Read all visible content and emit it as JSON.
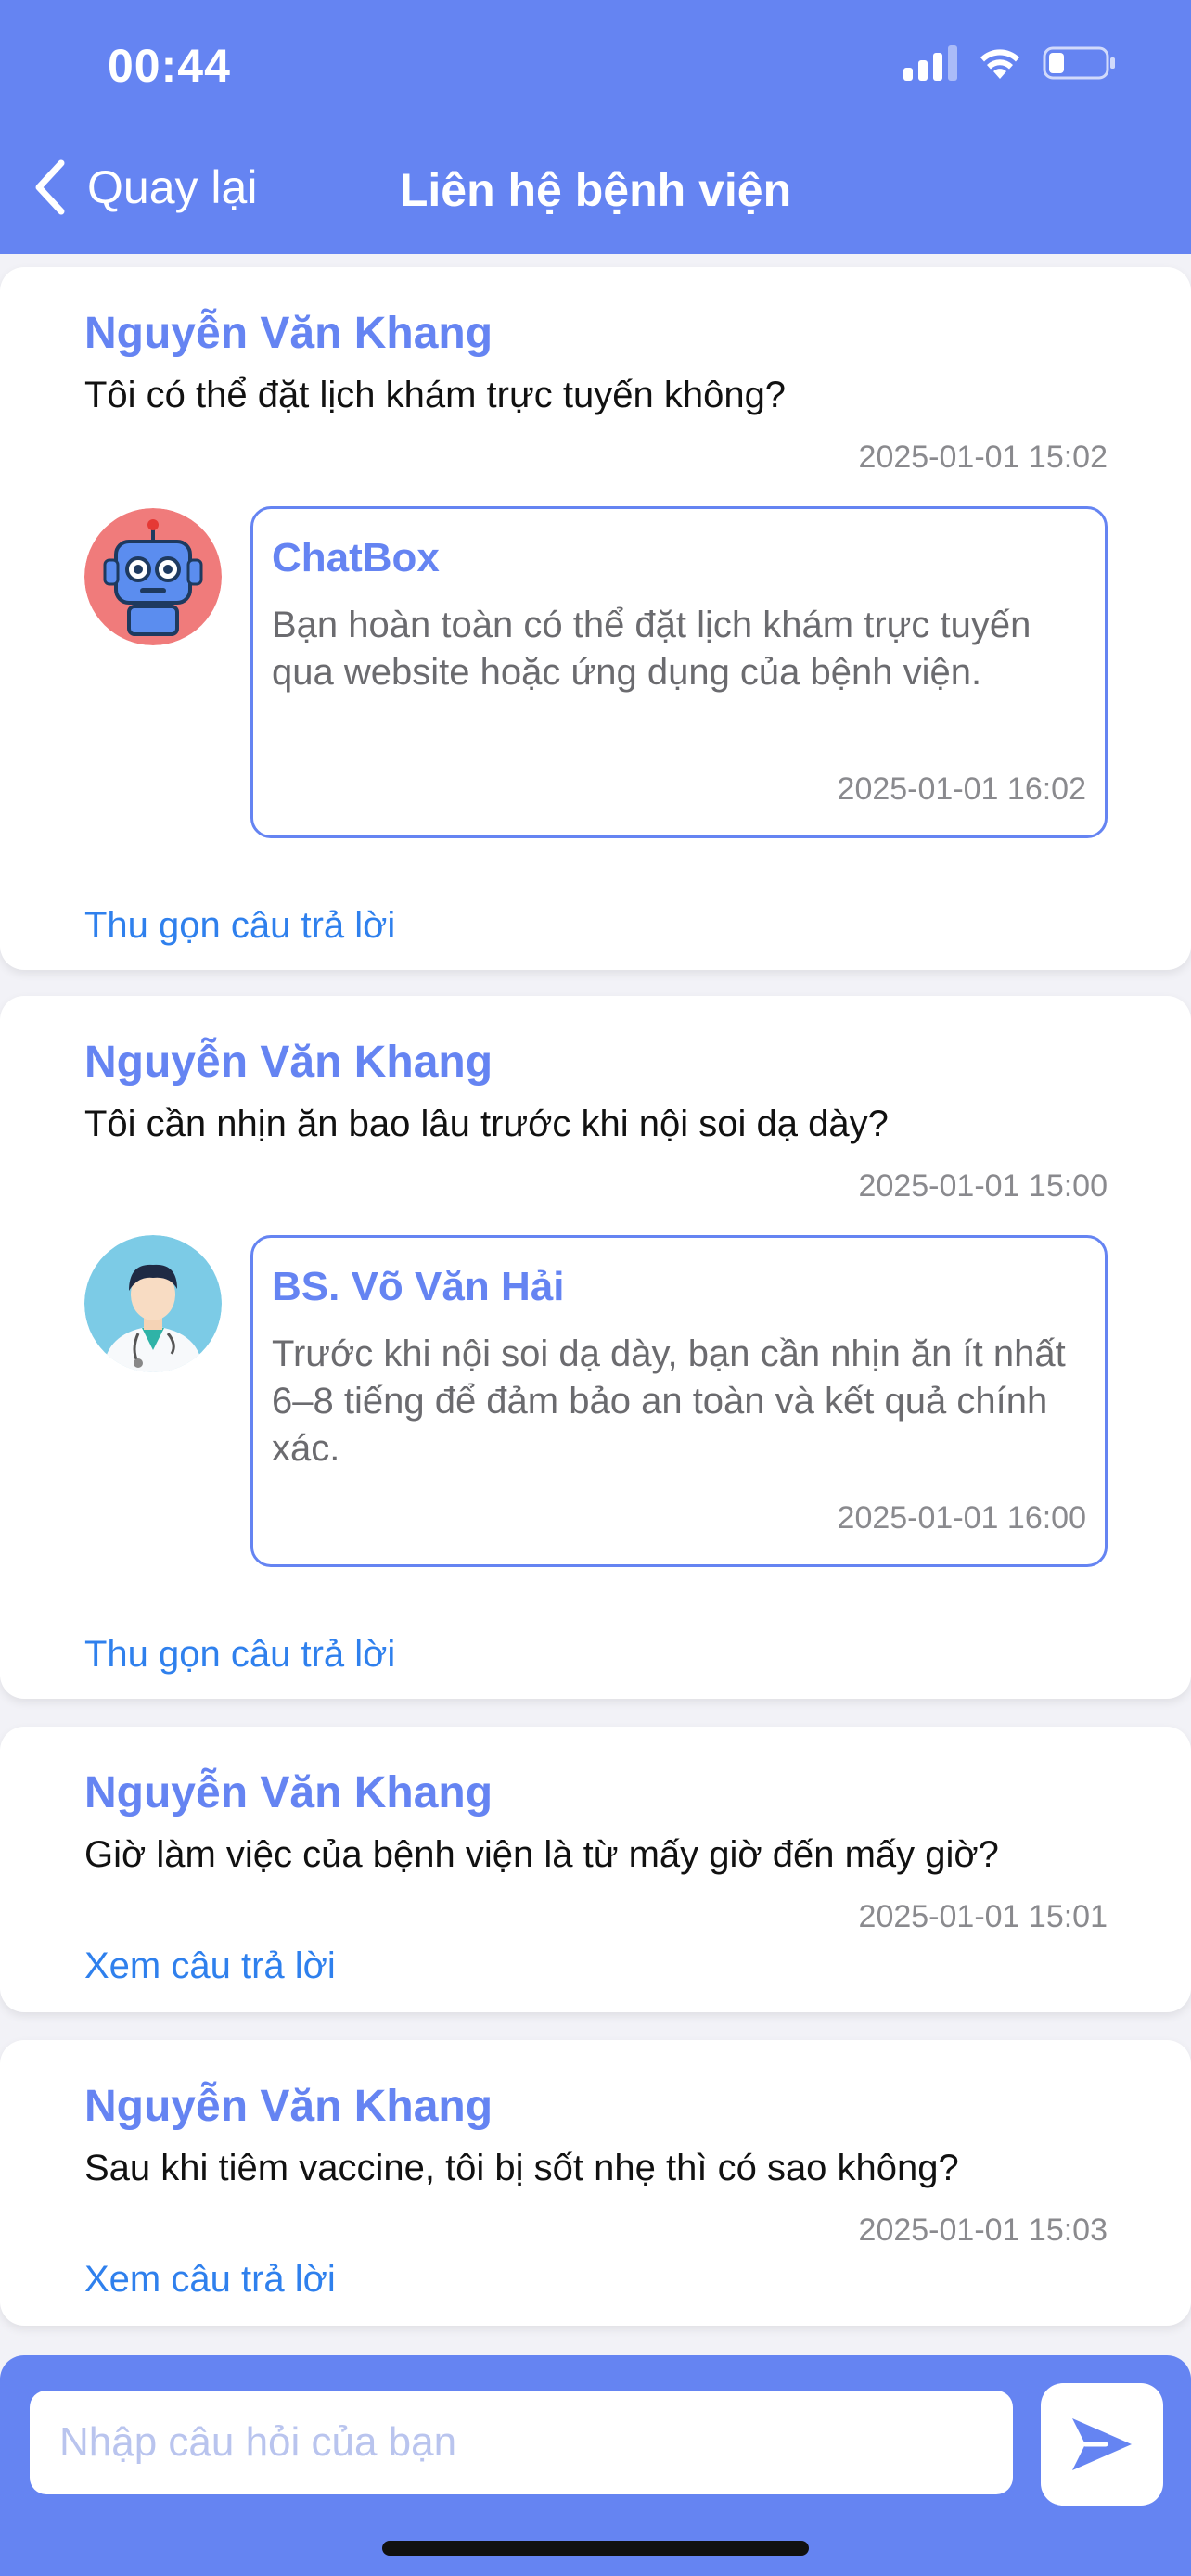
{
  "status_bar": {
    "time": "00:44"
  },
  "nav": {
    "back_label": "Quay lại",
    "title": "Liên hệ bệnh viện"
  },
  "threads": [
    {
      "asker": "Nguyễn Văn Khang",
      "question": "Tôi có thể đặt lịch khám trực tuyến không?",
      "question_time": "2025-01-01 15:02",
      "expanded": true,
      "responder": "ChatBox",
      "responder_avatar": "robot-avatar",
      "answer": "Bạn hoàn toàn có thể đặt lịch khám trực tuyến qua website hoặc ứng dụng của bệnh viện.",
      "answer_time": "2025-01-01 16:02",
      "toggle_label": "Thu gọn câu trả lời"
    },
    {
      "asker": "Nguyễn Văn Khang",
      "question": "Tôi cần nhịn ăn bao lâu trước khi nội soi dạ dày?",
      "question_time": "2025-01-01 15:00",
      "expanded": true,
      "responder": "BS. Võ Văn Hải",
      "responder_avatar": "doctor-avatar",
      "answer": "Trước khi nội soi dạ dày, bạn cần nhịn ăn ít nhất 6–8 tiếng để đảm bảo an toàn và kết quả chính xác.",
      "answer_time": "2025-01-01 16:00",
      "toggle_label": "Thu gọn câu trả lời"
    },
    {
      "asker": "Nguyễn Văn Khang",
      "question": "Giờ làm việc của bệnh viện là từ mấy giờ đến mấy giờ?",
      "question_time": "2025-01-01 15:01",
      "expanded": false,
      "toggle_label": "Xem câu trả lời"
    },
    {
      "asker": "Nguyễn Văn Khang",
      "question": "Sau khi tiêm vaccine, tôi bị sốt nhẹ thì có sao không?",
      "question_time": "2025-01-01 15:03",
      "expanded": false,
      "toggle_label": "Xem câu trả lời"
    }
  ],
  "composer": {
    "placeholder": "Nhập câu hỏi của bạn",
    "value": ""
  },
  "colors": {
    "primary": "#6584f2",
    "link": "#2f80ed",
    "muted": "#8a8a8e"
  }
}
